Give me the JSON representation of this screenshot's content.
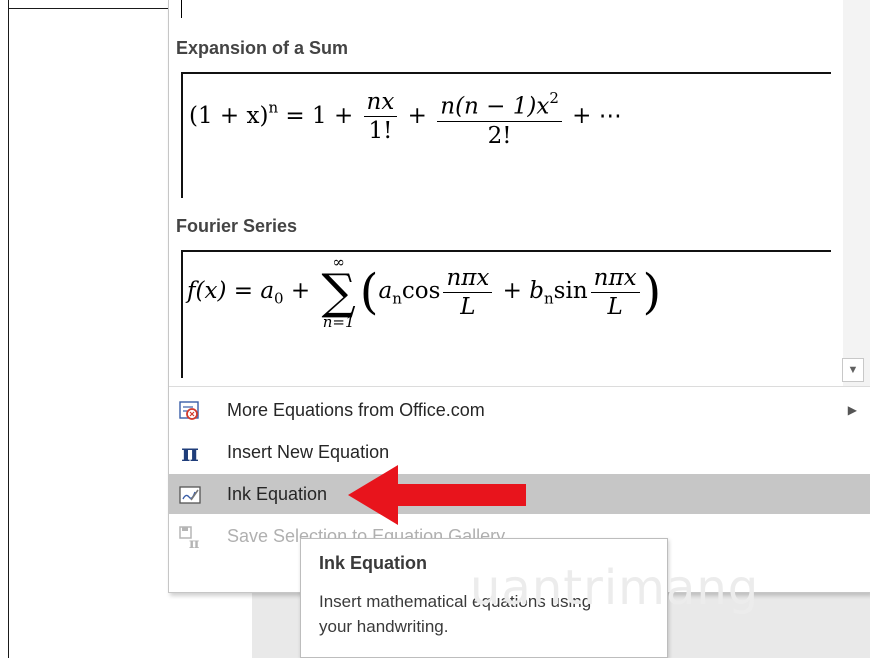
{
  "gallery": {
    "sections": [
      {
        "title": "Expansion of a Sum"
      },
      {
        "title": "Fourier Series"
      }
    ]
  },
  "equations": {
    "expansion": {
      "lhs": "(1 + x)",
      "lhs_exp": "n",
      "eq": " = 1 + ",
      "frac1_num": "nx",
      "frac1_den": "1!",
      "plus": " + ",
      "frac2_num": "n(n − 1)x",
      "frac2_num_exp": "2",
      "frac2_den": "2!",
      "tail": " + ⋯"
    },
    "fourier": {
      "lhs": "f(x) = a",
      "lhs_sub": "0",
      "plus": " + ",
      "sum_top": "∞",
      "sum_symbol": "∑",
      "sum_bot": "n=1",
      "open": "(",
      "a": "a",
      "a_sub": "n",
      "cos": "cos",
      "frac_num": "nπx",
      "frac_den": "L",
      "plus2": " + ",
      "b": "b",
      "b_sub": "n",
      "sin": "sin",
      "frac2_num": "nπx",
      "frac2_den": "L",
      "close": ")"
    }
  },
  "menu": {
    "items": [
      {
        "label": "More Equations from Office.com",
        "icon": "office-equations-icon",
        "has_submenu": true
      },
      {
        "label": "Insert New Equation",
        "icon": "pi-icon"
      },
      {
        "label": "Ink Equation",
        "icon": "ink-equation-icon",
        "highlighted": true
      },
      {
        "label": "Save Selection to Equation Gallery",
        "icon": "save-equation-icon",
        "disabled": true
      }
    ],
    "pi_glyph": "π",
    "submenu_arrow": "▶"
  },
  "tooltip": {
    "title": "Ink Equation",
    "body": "Insert mathematical equations using your handwriting."
  },
  "scroll_down_glyph": "▼",
  "watermark_text": "uantrimang",
  "colors": {
    "highlight": "#c6c6c6",
    "annotation_arrow": "#e8141c",
    "pi": "#1f3d7a"
  }
}
